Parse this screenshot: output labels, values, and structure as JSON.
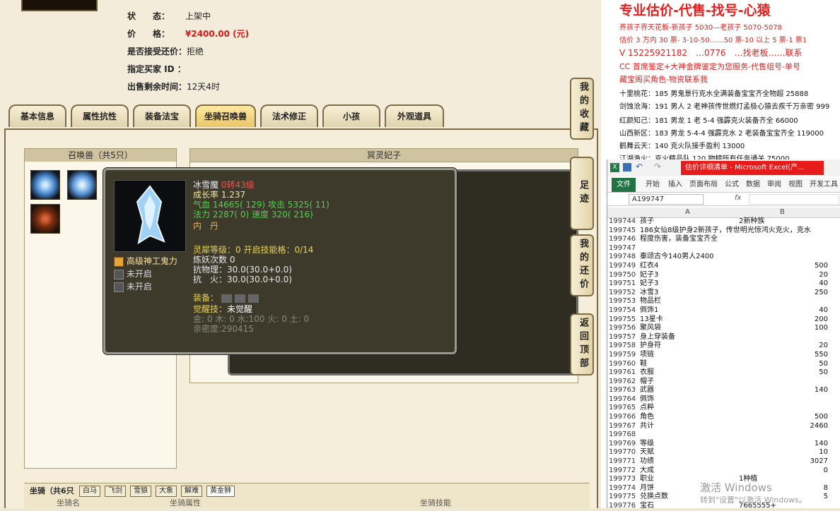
{
  "listing": {
    "status_label": "状　　态：",
    "status_value": "上架中",
    "price_label": "价　　格：",
    "price_value": "¥2400.00 (元)",
    "bargain_label": "是否接受还价：",
    "bargain_value": "拒绝",
    "buyer_label": "指定买家 ID ：",
    "buyer_value": "",
    "remaining_label": "出售剩余时间：",
    "remaining_value": "12天4时"
  },
  "tabs": [
    "基本信息",
    "属性抗性",
    "装备法宝",
    "坐骑召唤兽",
    "法术修正",
    "小孩",
    "外观道具"
  ],
  "active_tab": "坐骑召唤兽",
  "pet_list": {
    "title": "召唤兽（共5只）"
  },
  "detail": {
    "title": "冥灵妃子"
  },
  "tooltip": {
    "name": "冰雪魔",
    "reincarnation": "0转43级",
    "growth": "成长率 1.237",
    "hp_label": "气血",
    "hp": "14665( 129)",
    "atk_label": "攻击",
    "atk": "5325( 11)",
    "mp_label": "法力",
    "mp": "2287( 0)",
    "spd_label": "速度",
    "spd": "320( 216)",
    "inner_dan": "内　丹",
    "skill1": "高级神工鬼力",
    "skill2": "未开启",
    "skill3": "未开启",
    "soul_level": "灵犀等级：0 开启技能格：0/14",
    "refine": "炼妖次数 0",
    "phys_res": "抗物理：30.0(30.0+0.0)",
    "fire_res": "抗　火：30.0(30.0+0.0)",
    "equip_label": "装备：",
    "awaken": "觉醒技：",
    "awaken_value": "未觉醒",
    "elements": "金: 0 木: 0 水:100 火: 0 土: 0",
    "intimacy": "亲密度:290415"
  },
  "side_buttons": [
    "我的收藏",
    "足迹",
    "我的还价",
    "返回顶部"
  ],
  "mount": {
    "title": "坐骑（共6只",
    "tabs": [
      "白马",
      "飞剑",
      "雪狼",
      "大象",
      "解难",
      "黄金狮"
    ],
    "headers": [
      "坐骑名",
      "坐骑属性",
      "坐骑技能"
    ]
  },
  "ad": {
    "title": "专业估价-代售-找号-心猿",
    "lines_red": [
      "养孩子界天花板-新孩子 5030—老孩子 5070-5078",
      "估价 3 万内 30 票- 3-10-50……50 票-10 以上 5 票-1 票1",
      "V 15225921182　…0776　…找老板……联系",
      "CC 首席鉴定+大神金牌鉴定为您服务-代售组号-单号",
      "藏宝阁买角色-物资联系我"
    ],
    "lines_black": [
      "十里桃花：185 男鬼景行克水全满装备宝宝齐全物超 25888",
      "剑蚀沧海：191 男人 2 老神孩传世燃灯孟极心猿去疾千万亲密 999",
      "红颜知己：181 男龙 1 老 5-4 强霹克火装备齐全 66000",
      "山西新区：183 男龙 5-4-4 强霹克水 2 老装备宝宝齐全 119000",
      "鹤舞云天：140 克火队接手盈利 13000",
      "江湖渔火：克火精品队 120 物精所有任务通关 75000"
    ]
  },
  "excel": {
    "title": "估价详细清单 - Microsoft Excel(产…",
    "menu": [
      "文件",
      "开始",
      "插入",
      "页面布局",
      "公式",
      "数据",
      "审阅",
      "视图",
      "开发工具"
    ],
    "name_box": "A199747",
    "fx": "fx",
    "col_a": "A",
    "col_b": "B",
    "rows": [
      {
        "n": "199744",
        "a": "孩子",
        "b": "2新种族",
        "v": ""
      },
      {
        "n": "199745",
        "a": "186女仙8级护身2新孩子，传世明光惊鸿火克火，克水",
        "b": "",
        "v": ""
      },
      {
        "n": "199746",
        "a": "程度伤害，装备宝宝齐全",
        "b": "",
        "v": ""
      },
      {
        "n": "199747",
        "a": "",
        "b": "",
        "v": ""
      },
      {
        "n": "199748",
        "a": "秦颂古今140男人2400",
        "b": "",
        "v": ""
      },
      {
        "n": "199749",
        "a": "红衣4",
        "b": "",
        "v": "500"
      },
      {
        "n": "199750",
        "a": "妃子3",
        "b": "",
        "v": "20"
      },
      {
        "n": "199751",
        "a": "妃子3",
        "b": "",
        "v": "40"
      },
      {
        "n": "199752",
        "a": "冰雪3",
        "b": "",
        "v": "250"
      },
      {
        "n": "199753",
        "a": "物品栏",
        "b": "",
        "v": ""
      },
      {
        "n": "199754",
        "a": "佩饰1",
        "b": "",
        "v": "40"
      },
      {
        "n": "199755",
        "a": "13星卡",
        "b": "",
        "v": "200"
      },
      {
        "n": "199756",
        "a": "聚风袋",
        "b": "",
        "v": "100"
      },
      {
        "n": "199757",
        "a": "身上穿装备",
        "b": "",
        "v": ""
      },
      {
        "n": "199758",
        "a": "护身符",
        "b": "",
        "v": "20"
      },
      {
        "n": "199759",
        "a": "项链",
        "b": "",
        "v": "550"
      },
      {
        "n": "199760",
        "a": "鞋",
        "b": "",
        "v": "50"
      },
      {
        "n": "199761",
        "a": "衣服",
        "b": "",
        "v": "50"
      },
      {
        "n": "199762",
        "a": "帽子",
        "b": "",
        "v": ""
      },
      {
        "n": "199763",
        "a": "武器",
        "b": "",
        "v": "140"
      },
      {
        "n": "199764",
        "a": "佩饰",
        "b": "",
        "v": ""
      },
      {
        "n": "199765",
        "a": "点粹",
        "b": "",
        "v": ""
      },
      {
        "n": "199766",
        "a": "角色",
        "b": "",
        "v": "500"
      },
      {
        "n": "199767",
        "a": "共计",
        "b": "",
        "v": "2460"
      },
      {
        "n": "199768",
        "a": "",
        "b": "",
        "v": ""
      },
      {
        "n": "199769",
        "a": "等级",
        "b": "",
        "v": "140"
      },
      {
        "n": "199770",
        "a": "天赋",
        "b": "",
        "v": "10"
      },
      {
        "n": "199771",
        "a": "功绩",
        "b": "",
        "v": "3027"
      },
      {
        "n": "199772",
        "a": "大成",
        "b": "",
        "v": "0"
      },
      {
        "n": "199773",
        "a": "职业",
        "b": "1种植",
        "v": ""
      },
      {
        "n": "199774",
        "a": "月饼",
        "b": "",
        "v": "8"
      },
      {
        "n": "199775",
        "a": "兑换点数",
        "b": "",
        "v": "5"
      },
      {
        "n": "199776",
        "a": "宝石",
        "b": "7665555+",
        "v": ""
      }
    ]
  },
  "watermark": {
    "line1": "激活 Windows",
    "line2": "转到\"设置\"以激活 Windows。"
  }
}
